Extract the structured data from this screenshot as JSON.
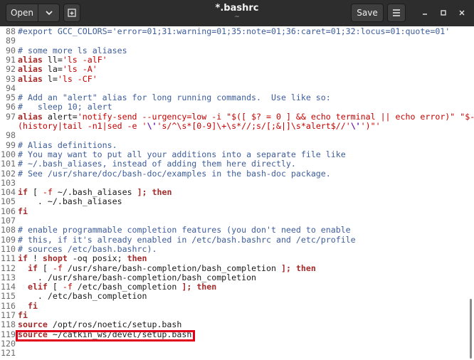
{
  "toolbar": {
    "open_label": "Open",
    "title": "*.bashrc",
    "subtitle": "~",
    "save_label": "Save"
  },
  "icons": {
    "open_dropdown": "chevron-down-icon",
    "new_tab": "new-tab-icon",
    "menu": "hamburger-menu-icon",
    "minimize": "minimize-icon",
    "maximize": "maximize-icon",
    "close": "close-icon"
  },
  "colors": {
    "titlebar": "#2d2d2d",
    "comment": "#3d5d9b",
    "keyword": "#a52a2a",
    "string": "#c40000",
    "highlight_box": "#e0001b"
  },
  "editor": {
    "lines": [
      {
        "n": "88",
        "segs": [
          {
            "t": "#export GCC_COLORS='error=01;31:warning=01;35:note=01;36:caret=01;32:locus=01:quote=01'",
            "c": "c"
          }
        ]
      },
      {
        "n": "89",
        "segs": []
      },
      {
        "n": "90",
        "segs": [
          {
            "t": "# some more ls aliases",
            "c": "c"
          }
        ]
      },
      {
        "n": "91",
        "segs": [
          {
            "t": "alias",
            "c": "k"
          },
          {
            "t": " ll=",
            "c": ""
          },
          {
            "t": "'ls -alF'",
            "c": "s"
          }
        ]
      },
      {
        "n": "92",
        "segs": [
          {
            "t": "alias",
            "c": "k"
          },
          {
            "t": " la=",
            "c": ""
          },
          {
            "t": "'ls -A'",
            "c": "s"
          }
        ]
      },
      {
        "n": "93",
        "segs": [
          {
            "t": "alias",
            "c": "k"
          },
          {
            "t": " l=",
            "c": ""
          },
          {
            "t": "'ls -CF'",
            "c": "s"
          }
        ]
      },
      {
        "n": "94",
        "segs": []
      },
      {
        "n": "95",
        "segs": [
          {
            "t": "# Add an \"alert\" alias for long running commands.  Use like so:",
            "c": "c"
          }
        ]
      },
      {
        "n": "96",
        "segs": [
          {
            "t": "#   sleep 10; alert",
            "c": "c"
          }
        ]
      },
      {
        "n": "97",
        "segs": [
          {
            "t": "alias",
            "c": "k"
          },
          {
            "t": " alert=",
            "c": ""
          },
          {
            "t": "'notify-send --urgency=low -i \"$([ $? = 0 ] && echo terminal || echo error)\" \"$-",
            "c": "s"
          }
        ]
      },
      {
        "n": "",
        "segs": [
          {
            "t": "(history|tail -n1|sed -e '",
            "c": "s"
          },
          {
            "t": "\\'",
            "c": "o"
          },
          {
            "t": "'s/^\\s*[0-9]\\+\\s*//;s/[;&|]\\s*alert$//'",
            "c": "s"
          },
          {
            "t": "\\'",
            "c": "o"
          },
          {
            "t": "')\"'",
            "c": "s"
          }
        ]
      },
      {
        "n": "98",
        "segs": []
      },
      {
        "n": "99",
        "segs": [
          {
            "t": "# Alias definitions.",
            "c": "c"
          }
        ]
      },
      {
        "n": "100",
        "segs": [
          {
            "t": "# You may want to put all your additions into a separate file like",
            "c": "c"
          }
        ]
      },
      {
        "n": "101",
        "segs": [
          {
            "t": "# ~/.bash_aliases, instead of adding them here directly.",
            "c": "c"
          }
        ]
      },
      {
        "n": "102",
        "segs": [
          {
            "t": "# See /usr/share/doc/bash-doc/examples in the bash-doc package.",
            "c": "c"
          }
        ]
      },
      {
        "n": "103",
        "segs": []
      },
      {
        "n": "104",
        "segs": [
          {
            "t": "if",
            "c": "k"
          },
          {
            "t": " [ ",
            "c": ""
          },
          {
            "t": "-f",
            "c": "s"
          },
          {
            "t": " ~/.bash_aliases ",
            "c": ""
          },
          {
            "t": "];",
            "c": "k"
          },
          {
            "t": " ",
            "c": ""
          },
          {
            "t": "then",
            "c": "k"
          }
        ]
      },
      {
        "n": "105",
        "segs": [
          {
            "t": "    . ~/.bash_aliases",
            "c": ""
          }
        ]
      },
      {
        "n": "106",
        "segs": [
          {
            "t": "fi",
            "c": "k"
          }
        ]
      },
      {
        "n": "107",
        "segs": []
      },
      {
        "n": "108",
        "segs": [
          {
            "t": "# enable programmable completion features (you don't need to enable",
            "c": "c"
          }
        ]
      },
      {
        "n": "109",
        "segs": [
          {
            "t": "# this, if it's already enabled in /etc/bash.bashrc and /etc/profile",
            "c": "c"
          }
        ]
      },
      {
        "n": "110",
        "segs": [
          {
            "t": "# sources /etc/bash.bashrc).",
            "c": "c"
          }
        ]
      },
      {
        "n": "111",
        "segs": [
          {
            "t": "if",
            "c": "k"
          },
          {
            "t": " ! ",
            "c": ""
          },
          {
            "t": "shopt",
            "c": "k"
          },
          {
            "t": " -oq posix; ",
            "c": ""
          },
          {
            "t": "then",
            "c": "k"
          }
        ]
      },
      {
        "n": "112",
        "segs": [
          {
            "t": "  ",
            "c": ""
          },
          {
            "t": "if",
            "c": "k"
          },
          {
            "t": " [ ",
            "c": ""
          },
          {
            "t": "-f",
            "c": "s"
          },
          {
            "t": " /usr/share/bash-completion/bash_completion ",
            "c": ""
          },
          {
            "t": "];",
            "c": "k"
          },
          {
            "t": " ",
            "c": ""
          },
          {
            "t": "then",
            "c": "k"
          }
        ]
      },
      {
        "n": "113",
        "segs": [
          {
            "t": "    . /usr/share/bash-completion/bash_completion",
            "c": ""
          }
        ]
      },
      {
        "n": "114",
        "segs": [
          {
            "t": "  ",
            "c": ""
          },
          {
            "t": "elif",
            "c": "k"
          },
          {
            "t": " [ ",
            "c": ""
          },
          {
            "t": "-f",
            "c": "s"
          },
          {
            "t": " /etc/bash_completion ",
            "c": ""
          },
          {
            "t": "];",
            "c": "k"
          },
          {
            "t": " ",
            "c": ""
          },
          {
            "t": "then",
            "c": "k"
          }
        ]
      },
      {
        "n": "115",
        "segs": [
          {
            "t": "    . /etc/bash_completion",
            "c": ""
          }
        ]
      },
      {
        "n": "116",
        "segs": [
          {
            "t": "  ",
            "c": ""
          },
          {
            "t": "fi",
            "c": "k"
          }
        ]
      },
      {
        "n": "117",
        "segs": [
          {
            "t": "fi",
            "c": "k"
          }
        ]
      },
      {
        "n": "118",
        "segs": [
          {
            "t": "source",
            "c": "k"
          },
          {
            "t": " /opt/ros/noetic/setup.bash",
            "c": ""
          }
        ]
      },
      {
        "n": "119",
        "segs": [
          {
            "t": "source",
            "c": "k"
          },
          {
            "t": " ~/catkin_ws/devel/setup.bash",
            "c": ""
          }
        ]
      },
      {
        "n": "120",
        "segs": []
      },
      {
        "n": "121",
        "segs": []
      }
    ]
  }
}
